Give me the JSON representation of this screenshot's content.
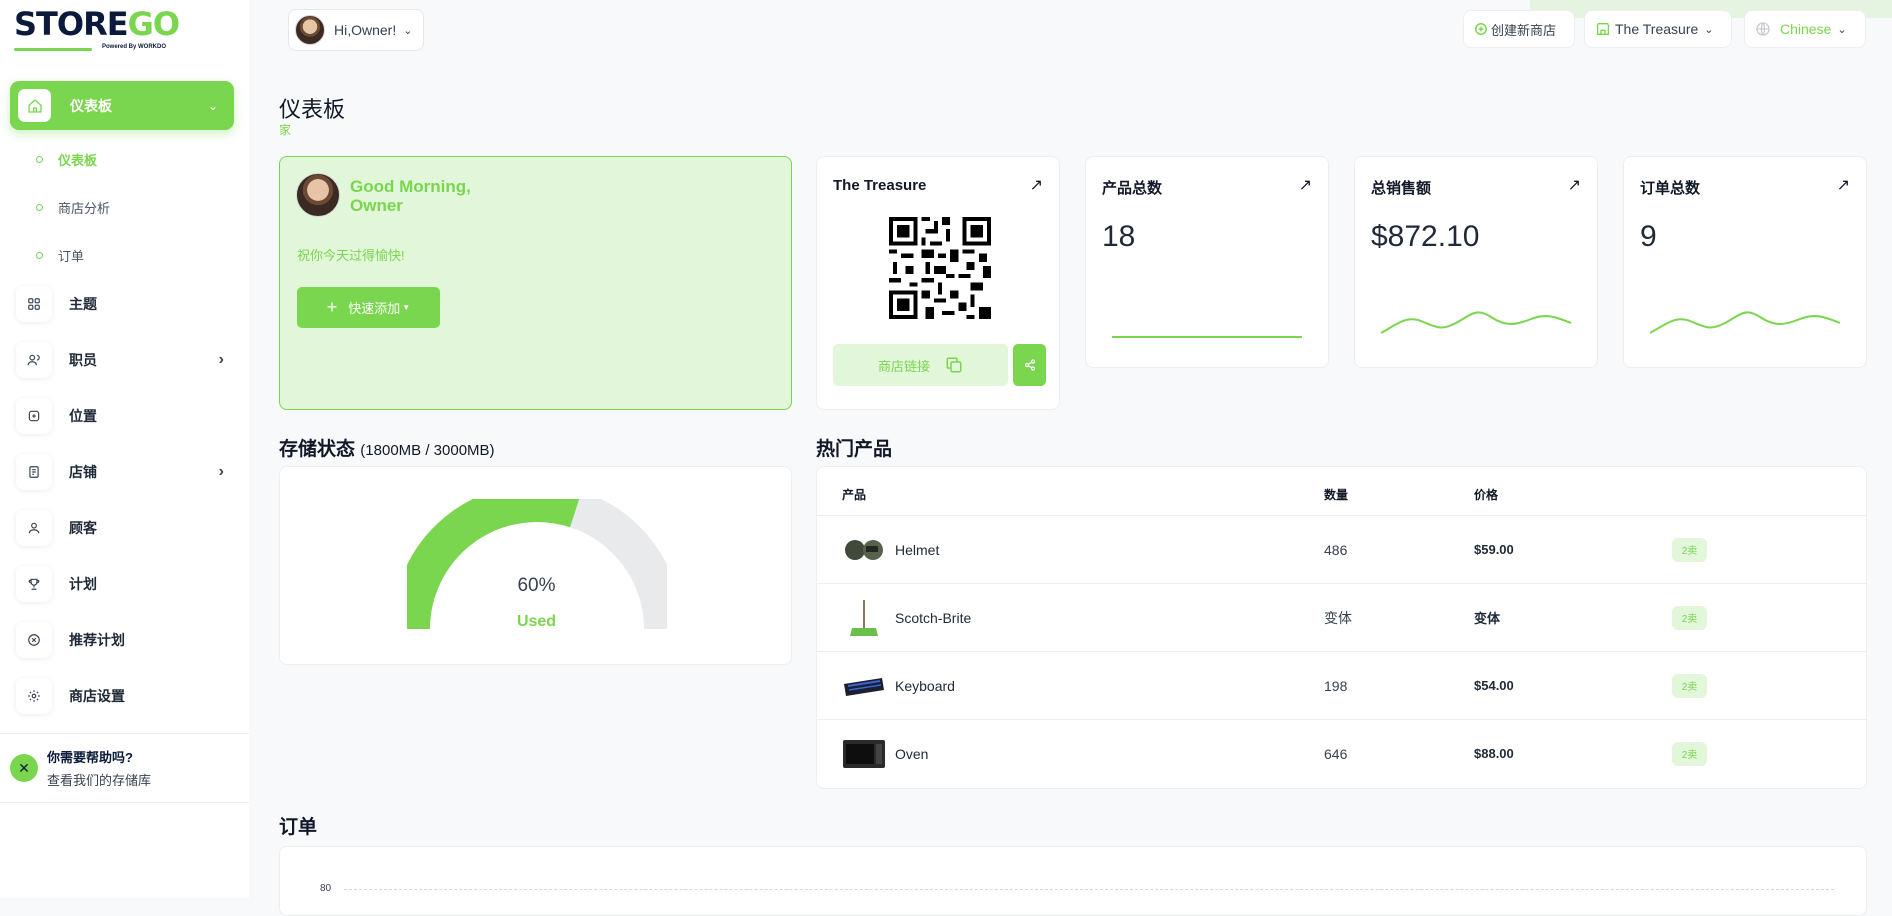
{
  "brand": {
    "logo_main": "STORE",
    "logo_accent": "GO",
    "logo_sub": "Powered By WORKDO"
  },
  "user": {
    "greeting": "Hi,Owner!"
  },
  "topbar": {
    "create_store": "创建新商店",
    "store_name": "The Treasure",
    "language": "Chinese"
  },
  "sidebar": {
    "active": {
      "label": "仪表板"
    },
    "subitems": [
      {
        "label": "仪表板"
      },
      {
        "label": "商店分析"
      },
      {
        "label": "订单"
      }
    ],
    "items": [
      {
        "label": "主题",
        "icon": "grid-icon"
      },
      {
        "label": "职员",
        "icon": "users-icon"
      },
      {
        "label": "位置",
        "icon": "location-icon"
      },
      {
        "label": "店铺",
        "icon": "store-icon"
      },
      {
        "label": "顾客",
        "icon": "user-icon"
      },
      {
        "label": "计划",
        "icon": "trophy-icon"
      },
      {
        "label": "推荐计划",
        "icon": "referral-icon"
      },
      {
        "label": "商店设置",
        "icon": "gear-icon"
      }
    ],
    "help_title": "你需要帮助吗?",
    "help_sub": "查看我们的存储库"
  },
  "page": {
    "title": "仪表板",
    "breadcrumb": "家"
  },
  "welcome": {
    "line1": "Good Morning,",
    "line2": "Owner",
    "wish": "祝你今天过得愉快!",
    "quick_add": "快速添加"
  },
  "store_card": {
    "title": "The Treasure",
    "link_label": "商店链接"
  },
  "stats": [
    {
      "title": "产品总数",
      "value": "18"
    },
    {
      "title": "总销售额",
      "value": "$872.10"
    },
    {
      "title": "订单总数",
      "value": "9"
    }
  ],
  "storage": {
    "title": "存储状态",
    "detail": "(1800MB / 3000MB)",
    "percent_label": "60%",
    "used_label": "Used",
    "used_fraction": 0.6
  },
  "popular": {
    "title": "热门产品",
    "headers": {
      "product": "产品",
      "qty": "数量",
      "price": "价格"
    },
    "rows": [
      {
        "name": "Helmet",
        "qty": "486",
        "price": "$59.00",
        "tag": "2卖"
      },
      {
        "name": "Scotch-Brite",
        "qty": "变体",
        "price": "变体",
        "tag": "2卖"
      },
      {
        "name": "Keyboard",
        "qty": "198",
        "price": "$54.00",
        "tag": "2卖"
      },
      {
        "name": "Oven",
        "qty": "646",
        "price": "$88.00",
        "tag": "2卖"
      }
    ]
  },
  "orders": {
    "title": "订单",
    "axis_tick": "80"
  },
  "colors": {
    "accent": "#7ad64f",
    "accent_light": "#e2f6da",
    "navy": "#0b1a3a"
  }
}
